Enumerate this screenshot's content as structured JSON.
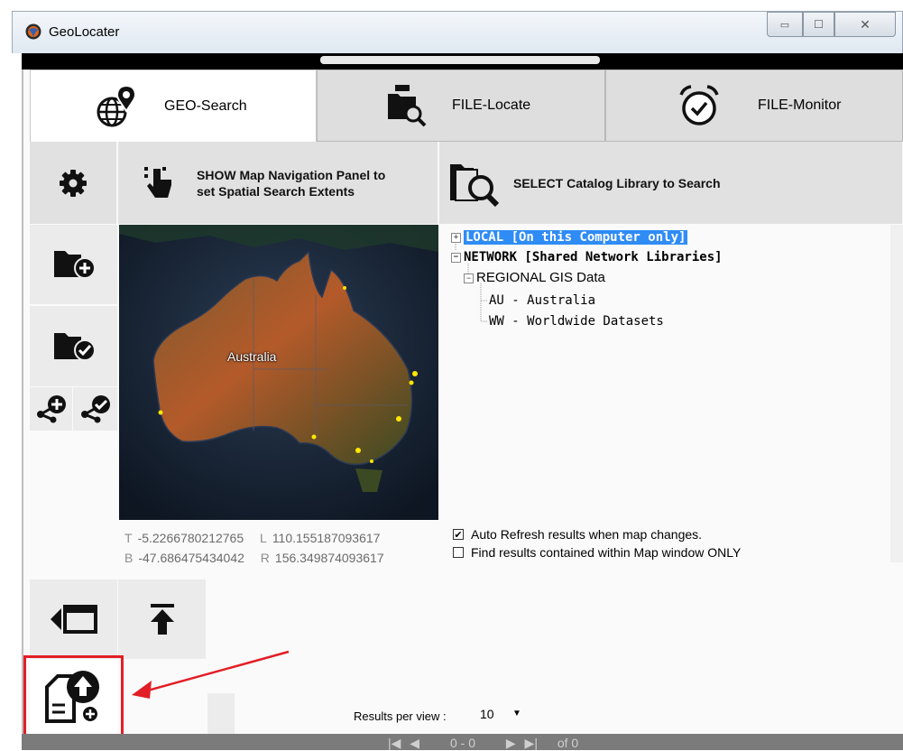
{
  "window": {
    "title": "GeoLocater",
    "minimize": "▭",
    "maximize": "☐",
    "close": "✕"
  },
  "tabs": [
    {
      "label": "GEO-Search",
      "icon": "globe-pin-icon"
    },
    {
      "label": "FILE-Locate",
      "icon": "folder-search-icon"
    },
    {
      "label": "FILE-Monitor",
      "icon": "alarm-clock-icon"
    }
  ],
  "toolbar": {
    "nav_label_line1": "SHOW Map Navigation Panel to",
    "nav_label_line2": "set Spatial Search Extents",
    "catalog_label": "SELECT Catalog Library to Search"
  },
  "map": {
    "label": "Australia"
  },
  "coords": {
    "t_key": "T",
    "t_val": "-5.2266780212765",
    "l_key": "L",
    "l_val": "110.155187093617",
    "b_key": "B",
    "b_val": "-47.686475434042",
    "r_key": "R",
    "r_val": "156.349874093617"
  },
  "tree": {
    "local": "LOCAL  [On this Computer only]",
    "network": "NETWORK  [Shared Network Libraries]",
    "regional": "REGIONAL GIS Data",
    "au": "AU - Australia",
    "ww": "WW - Worldwide Datasets"
  },
  "options": {
    "auto_refresh": "Auto Refresh results when map changes.",
    "auto_refresh_checked": true,
    "contained_only": "Find results contained within Map window ONLY",
    "contained_only_checked": false
  },
  "results": {
    "label": "Results per view :",
    "value": "10"
  },
  "pager": {
    "text": "0 - 0",
    "of": "of 0"
  },
  "colors": {
    "highlight": "#e21f26",
    "selection": "#2f8cf5"
  }
}
